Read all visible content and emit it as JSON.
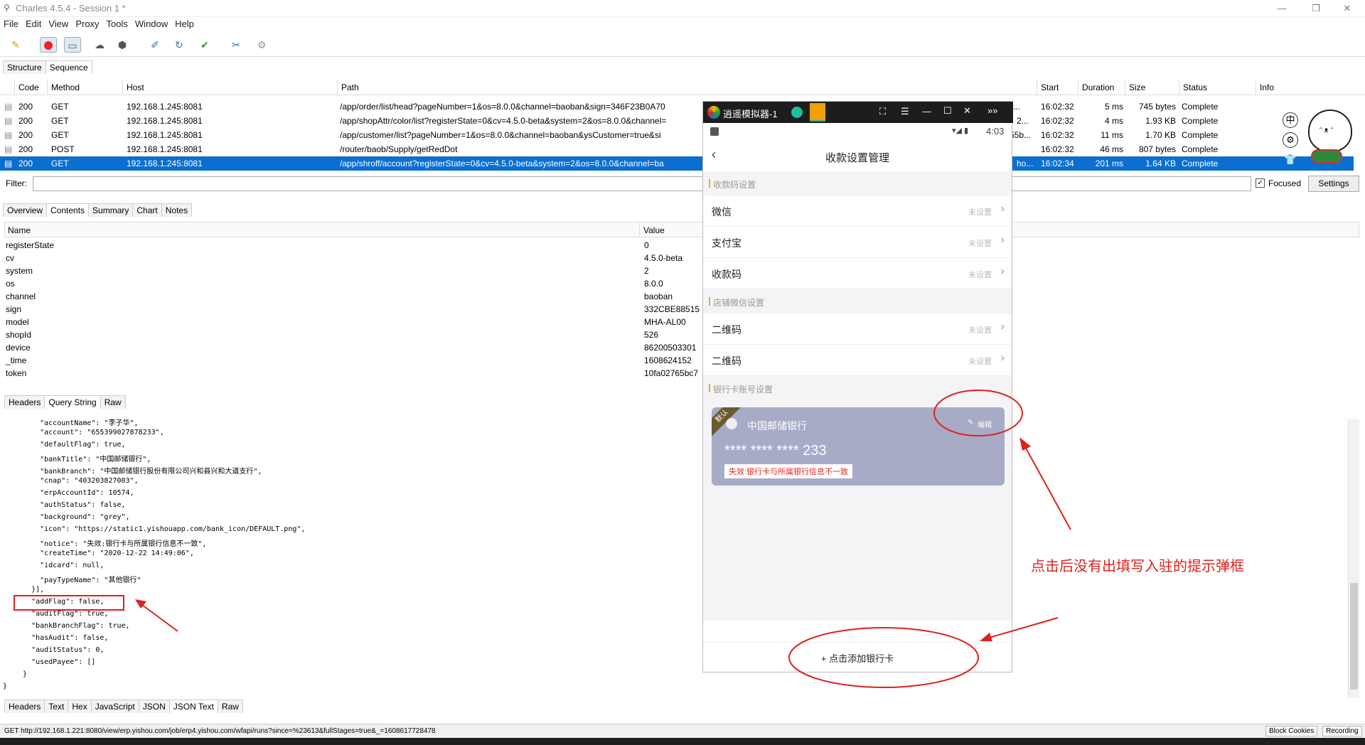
{
  "window": {
    "title": "Charles 4.5.4 - Session 1 *"
  },
  "menu": [
    "File",
    "Edit",
    "View",
    "Proxy",
    "Tools",
    "Window",
    "Help"
  ],
  "view_tabs": [
    "Structure",
    "Sequence"
  ],
  "columns": [
    "Code",
    "Method",
    "Host",
    "Path",
    "Start",
    "Duration",
    "Size",
    "Status",
    "Info"
  ],
  "rows": [
    {
      "code": "200",
      "method": "GET",
      "host": "192.168.1.245:8081",
      "path": "/app/order/list/head?pageNumber=1&os=8.0.0&channel=baoban&sign=346F23B0A70",
      "start": "16:02:32",
      "duration": "5 ms",
      "size": "745 bytes",
      "status": "Complete",
      "extra": "0c4..."
    },
    {
      "code": "200",
      "method": "GET",
      "host": "192.168.1.245:8081",
      "path": "/app/shopAttr/color/list?registerState=0&cv=4.5.0-beta&system=2&os=8.0.0&channel=",
      "start": "16:02:32",
      "duration": "4 ms",
      "size": "1.93 KB",
      "status": "Complete",
      "extra": "2..."
    },
    {
      "code": "200",
      "method": "GET",
      "host": "192.168.1.245:8081",
      "path": "/app/customer/list?pageNumber=1&os=8.0.0&channel=baoban&ysCustomer=true&si",
      "start": "16:02:32",
      "duration": "11 ms",
      "size": "1.70 KB",
      "status": "Complete",
      "extra": "55b..."
    },
    {
      "code": "200",
      "method": "POST",
      "host": "192.168.1.245:8081",
      "path": "/router/baob/Supply/getRedDot",
      "start": "16:02:32",
      "duration": "46 ms",
      "size": "807 bytes",
      "status": "Complete",
      "extra": ""
    },
    {
      "code": "200",
      "method": "GET",
      "host": "192.168.1.245:8081",
      "path": "/app/shroff/account?registerState=0&cv=4.5.0-beta&system=2&os=8.0.0&channel=ba",
      "start": "16:02:34",
      "duration": "201 ms",
      "size": "1.64 KB",
      "status": "Complete",
      "extra": "ho..."
    }
  ],
  "filter": {
    "label": "Filter:",
    "value": "",
    "focused_label": "Focused",
    "settings_label": "Settings"
  },
  "detail_tabs": [
    "Overview",
    "Contents",
    "Summary",
    "Chart",
    "Notes"
  ],
  "param_headers": {
    "name": "Name",
    "value": "Value"
  },
  "params": [
    {
      "name": "registerState",
      "value": "0"
    },
    {
      "name": "cv",
      "value": "4.5.0-beta"
    },
    {
      "name": "system",
      "value": "2"
    },
    {
      "name": "os",
      "value": "8.0.0"
    },
    {
      "name": "channel",
      "value": "baoban"
    },
    {
      "name": "sign",
      "value": "332CBE88515"
    },
    {
      "name": "model",
      "value": "MHA-AL00"
    },
    {
      "name": "shopId",
      "value": "526"
    },
    {
      "name": "device",
      "value": "86200503301"
    },
    {
      "name": "_time",
      "value": "1608624152"
    },
    {
      "name": "token",
      "value": "10fa02765bc7"
    }
  ],
  "request_tabs": [
    "Headers",
    "Query String",
    "Raw"
  ],
  "json_lines": [
    "      \"accountName\": \"李子华\",",
    "      \"account\": \"655399027878233\",",
    "      \"defaultFlag\": true,",
    "      \"bankTitle\": \"中国邮储银行\",",
    "      \"bankBranch\": \"中国邮储银行股份有限公司兴和县兴和大道支行\",",
    "      \"cnap\": \"403203827003\",",
    "      \"erpAccountId\": 10574,",
    "      \"authStatus\": false,",
    "      \"background\": \"grey\",",
    "      \"icon\": \"https://static1.yishouapp.com/bank_icon/DEFAULT.png\",",
    "      \"notice\": \"失效:银行卡与所属银行信息不一致\",",
    "      \"createTime\": \"2020-12-22 14:49:06\",",
    "      \"idcard\": null,",
    "      \"payTypeName\": \"其他银行\"",
    "    }],",
    "    \"addFlag\": false,",
    "    \"auditFlag\": true,",
    "    \"bankBranchFlag\": true,",
    "    \"hasAudit\": false,",
    "    \"auditStatus\": 0,",
    "    \"usedPayee\": []",
    "  }",
    "}"
  ],
  "response_tabs": [
    "Headers",
    "Text",
    "Hex",
    "JavaScript",
    "JSON",
    "JSON Text",
    "Raw"
  ],
  "statusbar": {
    "url": "GET http://192.168.1.221:8080/view/erp.yishou.com/job/erp4.yishou.com/wfapi/runs?since=%23613&fullStages=true&_=1608617728478",
    "block_cookies": "Block Cookies",
    "recording": "Recording"
  },
  "emulator": {
    "title": "逍遥模拟器-1",
    "time": "4:03",
    "page_title": "收款设置管理",
    "sections": {
      "pay_code": "收款码设置",
      "wechat_store": "店铺微信设置",
      "bank": "银行卡账号设置"
    },
    "items": [
      {
        "label": "微信",
        "status": "未设置"
      },
      {
        "label": "支付宝",
        "status": "未设置"
      },
      {
        "label": "收款码",
        "status": "未设置"
      },
      {
        "label": "二维码",
        "status": "未设置"
      },
      {
        "label": "二维码",
        "status": "未设置"
      }
    ],
    "card": {
      "ribbon": "默认",
      "bank": "中国邮储银行",
      "edit": "编辑",
      "number": "**** **** **** 233",
      "notice": "失效:银行卡与所属银行信息不一致"
    },
    "add_button": "+ 点击添加银行卡"
  },
  "annotation": {
    "text": "点击后没有出填写入驻的提示弹框",
    "color": "#e0201b"
  }
}
